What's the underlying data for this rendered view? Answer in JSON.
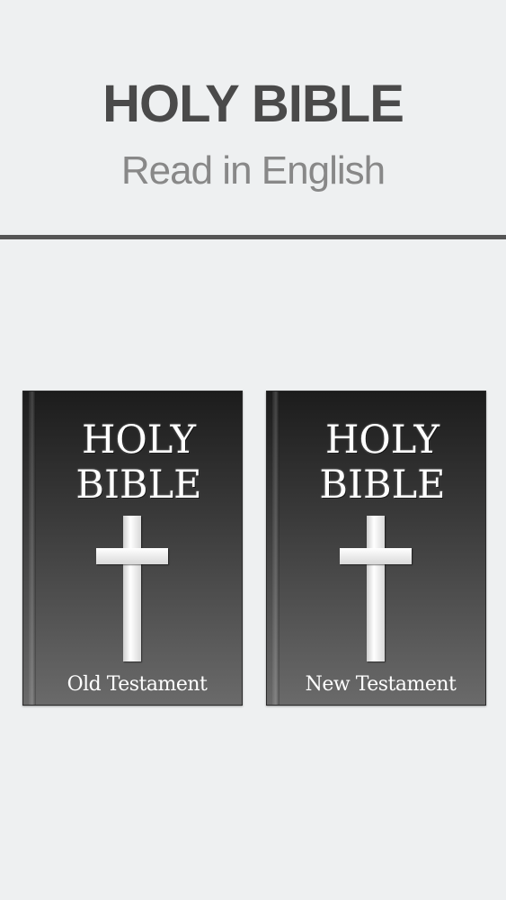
{
  "header": {
    "title": "HOLY BIBLE",
    "subtitle": "Read in English"
  },
  "books": [
    {
      "title_line1": "HOLY",
      "title_line2": "BIBLE",
      "caption": "Old Testament",
      "icon": "cross-icon"
    },
    {
      "title_line1": "HOLY",
      "title_line2": "BIBLE",
      "caption": "New Testament",
      "icon": "cross-icon"
    }
  ],
  "colors": {
    "background": "#eef0f1",
    "title": "#4a4a4a",
    "subtitle": "#888888",
    "divider": "#555555",
    "book_cover_top": "#1c1c1c",
    "book_cover_bottom": "#6a6a6a"
  }
}
